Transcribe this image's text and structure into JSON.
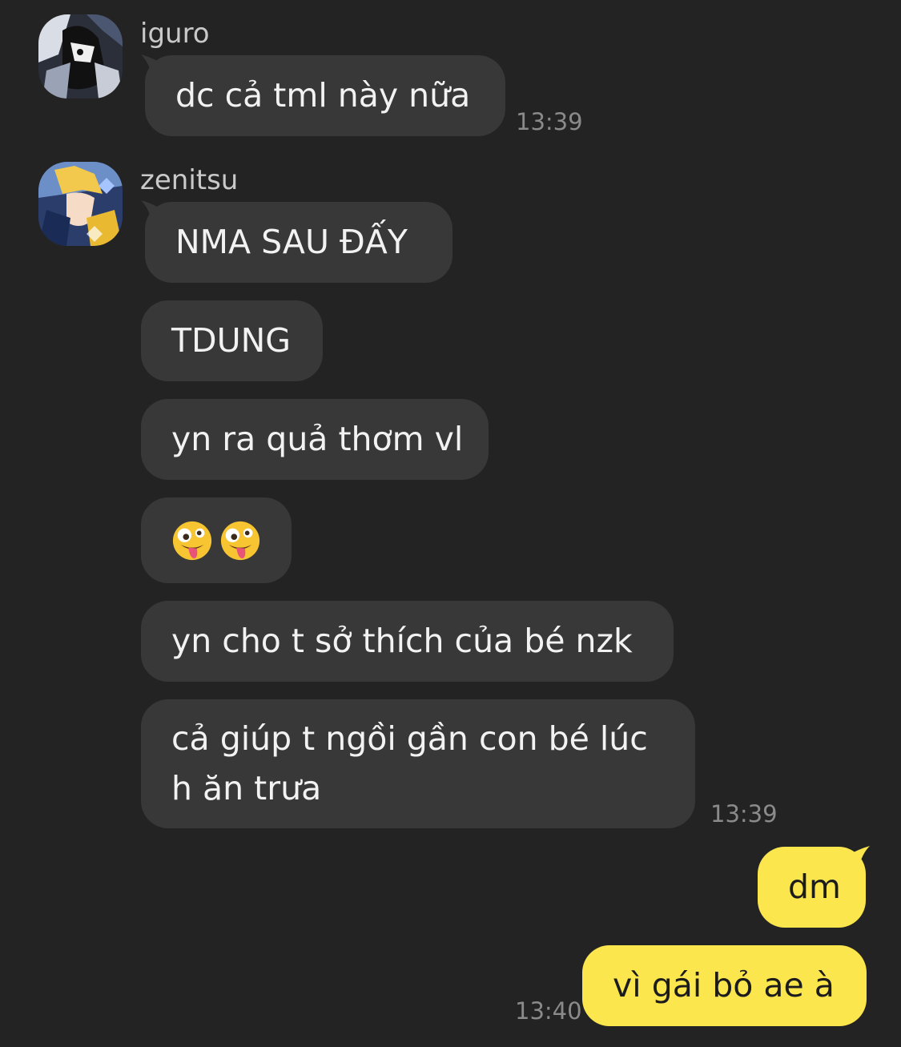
{
  "messages": [
    {
      "sender": "iguro",
      "text": "dc cả tml này nữa",
      "time": "13:39"
    },
    {
      "sender": "zenitsu",
      "texts": [
        "NMA SAU ĐẤY",
        "TDUNG",
        "yn ra quả thơm vl",
        "yn cho t sở thích của bé nzk",
        "cả giúp t ngồi gần con bé lúc h ăn trưa"
      ],
      "emoji_count": 2,
      "time": "13:39"
    },
    {
      "sender": "me",
      "texts": [
        "dm",
        "vì gái bỏ ae à"
      ],
      "time": "13:40"
    }
  ],
  "colors": {
    "background": "#232323",
    "incoming_bubble": "#383838",
    "outgoing_bubble": "#fbe64d"
  },
  "icons": {
    "emoji": "zany-face-icon"
  }
}
